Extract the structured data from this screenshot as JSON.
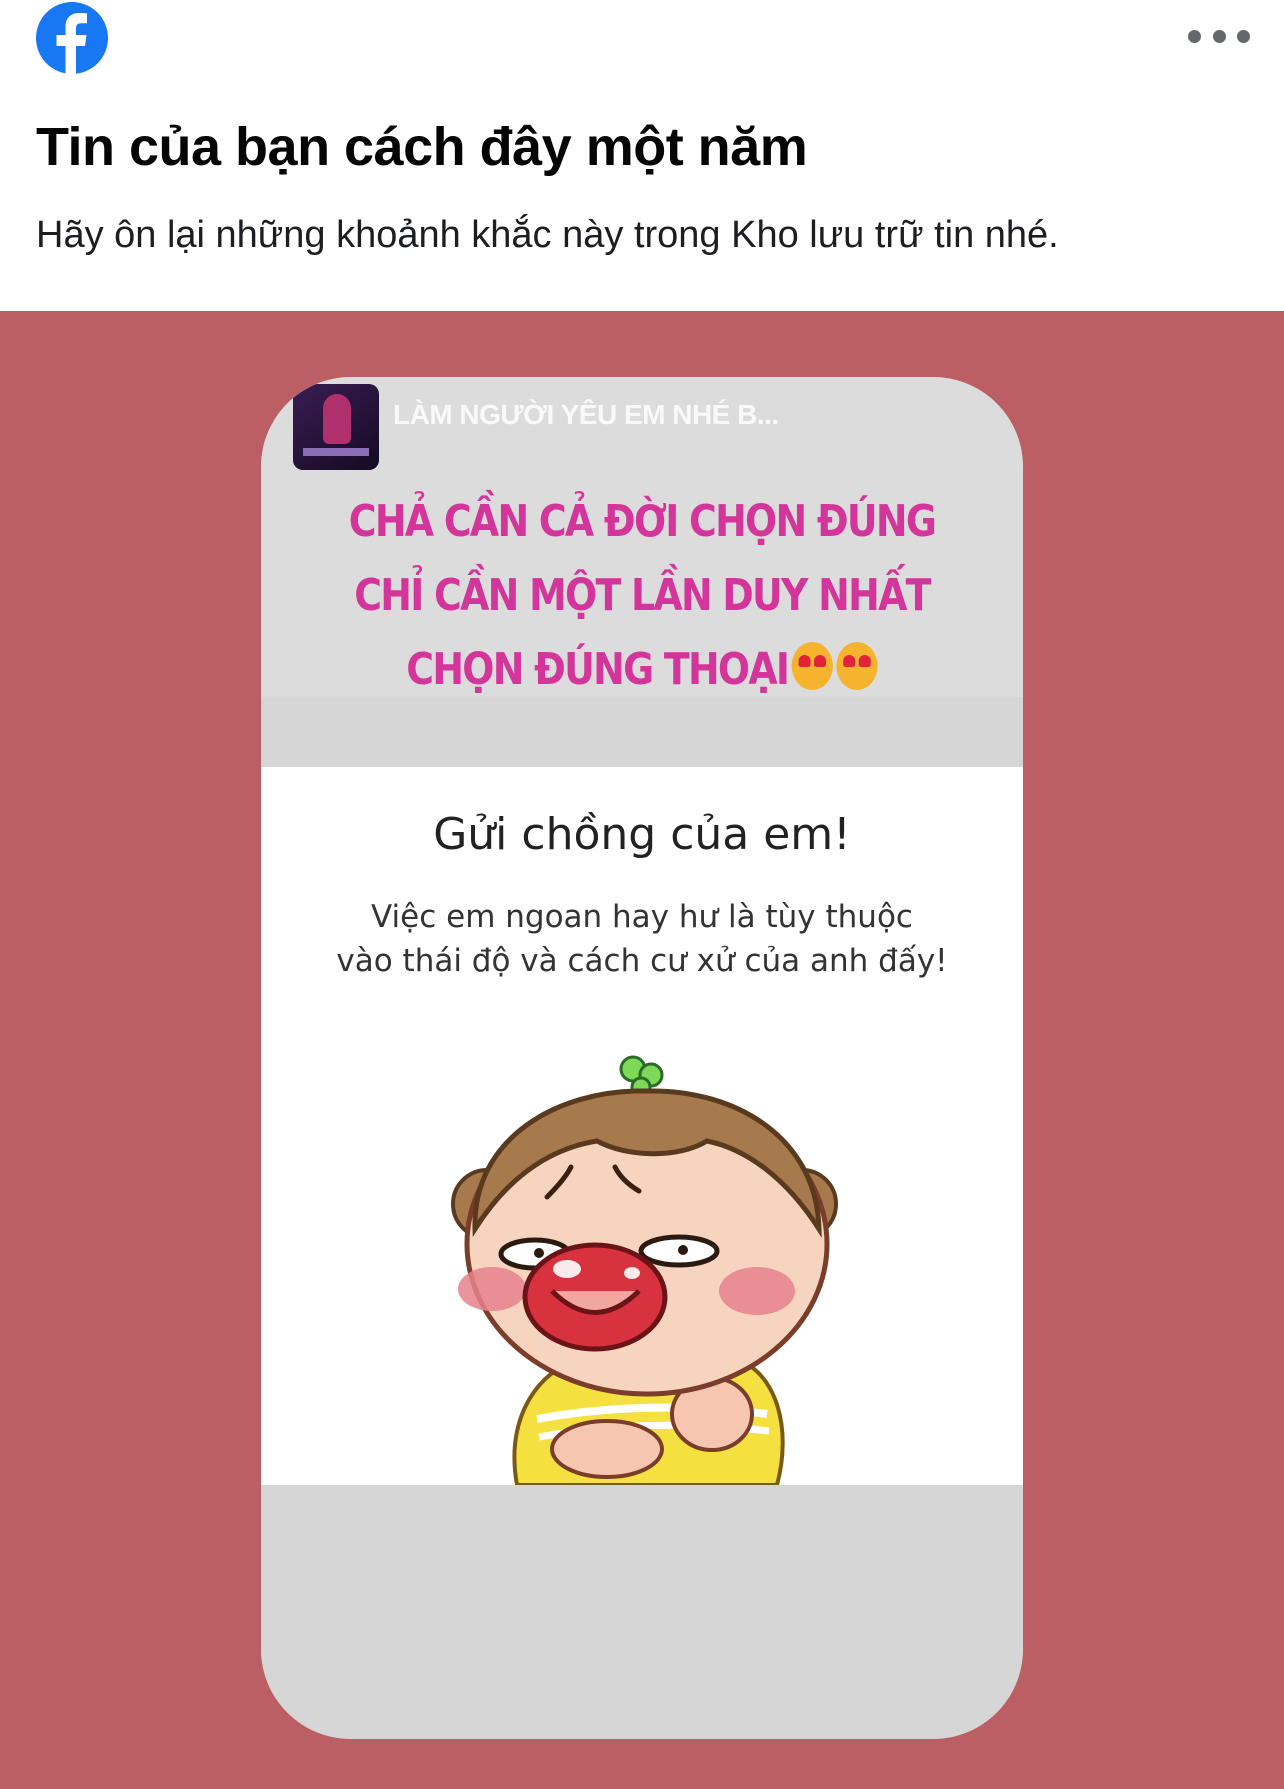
{
  "header": {
    "logo_icon": "facebook-logo-icon",
    "more_icon": "more-options-icon"
  },
  "memory": {
    "title": "Tin của bạn cách đây một năm",
    "subtitle": "Hãy ôn lại những khoảnh khắc này trong Kho lưu trữ tin nhé."
  },
  "story": {
    "music_title": "LÀM NGƯỜI YÊU EM NHÉ B...",
    "caption_lines": [
      "CHẢ CẦN CẢ ĐỜI CHỌN ĐÚNG",
      "CHỈ CẦN MỘT LẦN DUY NHẤT",
      "CHỌN ĐÚNG THOẠI"
    ],
    "emoji_icons": [
      "heart-eyes-emoji-icon",
      "heart-eyes-emoji-icon"
    ],
    "card_title": "Gửi chồng của em!",
    "card_body_lines": [
      "Việc em ngoan hay hư là tùy thuộc",
      "vào thái độ và cách cư xử của anh đấy!"
    ]
  },
  "colors": {
    "facebook_blue": "#1877f2",
    "background_pink": "#bb5f64",
    "caption_pink": "#d3359a",
    "story_gray": "#d6d6d6"
  }
}
